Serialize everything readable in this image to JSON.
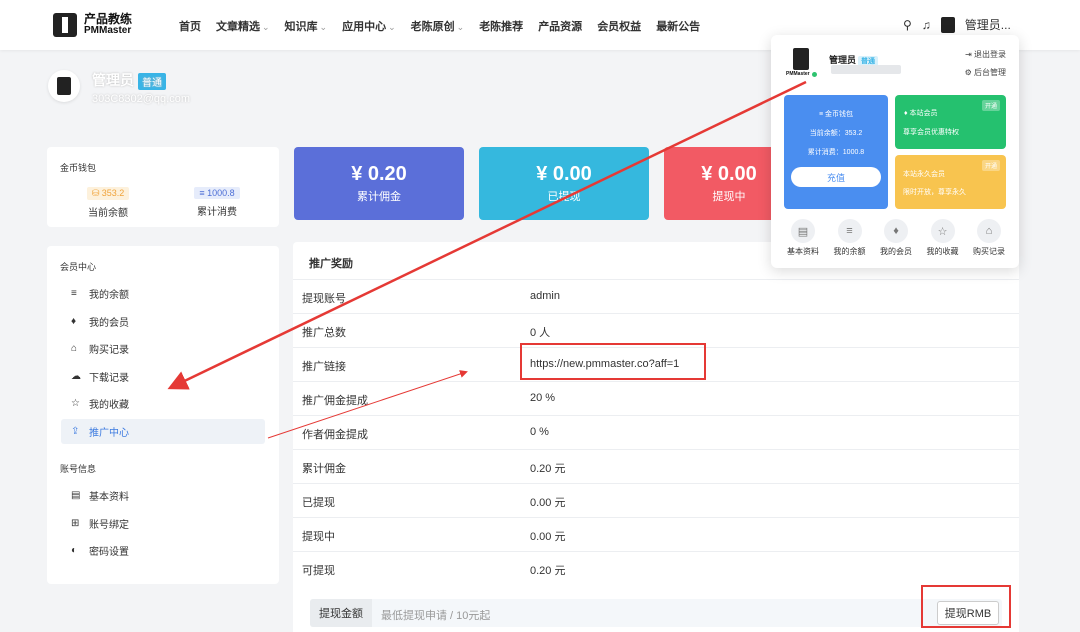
{
  "header": {
    "logo_cn": "产品教练",
    "logo_en": "PMMaster",
    "nav": [
      {
        "label": "首页",
        "dropdown": false
      },
      {
        "label": "文章精选",
        "dropdown": true
      },
      {
        "label": "知识库",
        "dropdown": true
      },
      {
        "label": "应用中心",
        "dropdown": true
      },
      {
        "label": "老陈原创",
        "dropdown": true
      },
      {
        "label": "老陈推荐",
        "dropdown": false
      },
      {
        "label": "产品资源",
        "dropdown": false
      },
      {
        "label": "会员权益",
        "dropdown": false
      },
      {
        "label": "最新公告",
        "dropdown": false
      }
    ],
    "chevron": "⌄",
    "search_icon": "⚲",
    "bell_icon": "♫",
    "user_name": "管理员..."
  },
  "profile": {
    "name": "管理员",
    "badge": "普通",
    "email": "303C8302@qq.com"
  },
  "wallet": {
    "title": "金币钱包",
    "balance": "353.2",
    "balance_label": "当前余额",
    "spent": "1000.8",
    "spent_label": "累计消费"
  },
  "stats": [
    {
      "value": "¥ 0.20",
      "label": "累计佣金",
      "color": "#5b6fd9"
    },
    {
      "value": "¥ 0.00",
      "label": "已提现",
      "color": "#35b8de"
    },
    {
      "value": "¥ 0.00",
      "label": "提现中",
      "color": "#f25a64"
    }
  ],
  "menu": {
    "member_section": "会员中心",
    "member_items": [
      {
        "label": "我的余额",
        "icon": "≡"
      },
      {
        "label": "我的会员",
        "icon": "♦"
      },
      {
        "label": "购买记录",
        "icon": "⌂"
      },
      {
        "label": "下载记录",
        "icon": "☁"
      },
      {
        "label": "我的收藏",
        "icon": "☆"
      },
      {
        "label": "推广中心",
        "icon": "⇪",
        "active": true
      }
    ],
    "account_section": "账号信息",
    "account_items": [
      {
        "label": "基本资料",
        "icon": "▤"
      },
      {
        "label": "账号绑定",
        "icon": "⊞"
      },
      {
        "label": "密码设置",
        "icon": "◐"
      }
    ]
  },
  "promo": {
    "title": "推广奖励",
    "rows": [
      {
        "key": "提现账号",
        "value": "admin"
      },
      {
        "key": "推广总数",
        "value": "0 人"
      },
      {
        "key": "推广链接",
        "value": "https://new.pmmaster.co?aff=1"
      },
      {
        "key": "推广佣金提成",
        "value": "20 %"
      },
      {
        "key": "作者佣金提成",
        "value": "0 %"
      },
      {
        "key": "累计佣金",
        "value": "0.20 元"
      },
      {
        "key": "已提现",
        "value": "0.00 元"
      },
      {
        "key": "提现中",
        "value": "0.00 元"
      },
      {
        "key": "可提现",
        "value": "0.20 元"
      }
    ],
    "withdraw_label": "提现金额",
    "withdraw_placeholder": "最低提现申请 / 10元起",
    "withdraw_button": "提现RMB"
  },
  "dropdown": {
    "name": "管理员",
    "badge": "普通",
    "logout": "⇥ 退出登录",
    "admin": "⚙ 后台管理",
    "coin_title": "≡ 金币钱包",
    "coin_balance": "当前余额：353.2",
    "coin_spent": "累计消费：1000.8",
    "recharge": "充值",
    "vip_title": "♦ 本站会员",
    "vip_desc": "尊享会员优惠特权",
    "vip_tag": "开通",
    "lifetime_title": "本站永久会员",
    "lifetime_desc": "限时开放，尊享永久",
    "lifetime_tag": "开通",
    "shortcuts": [
      {
        "label": "基本资料",
        "icon": "▤"
      },
      {
        "label": "我的余额",
        "icon": "≡"
      },
      {
        "label": "我的会员",
        "icon": "♦"
      },
      {
        "label": "我的收藏",
        "icon": "☆"
      },
      {
        "label": "购买记录",
        "icon": "⌂"
      }
    ]
  }
}
